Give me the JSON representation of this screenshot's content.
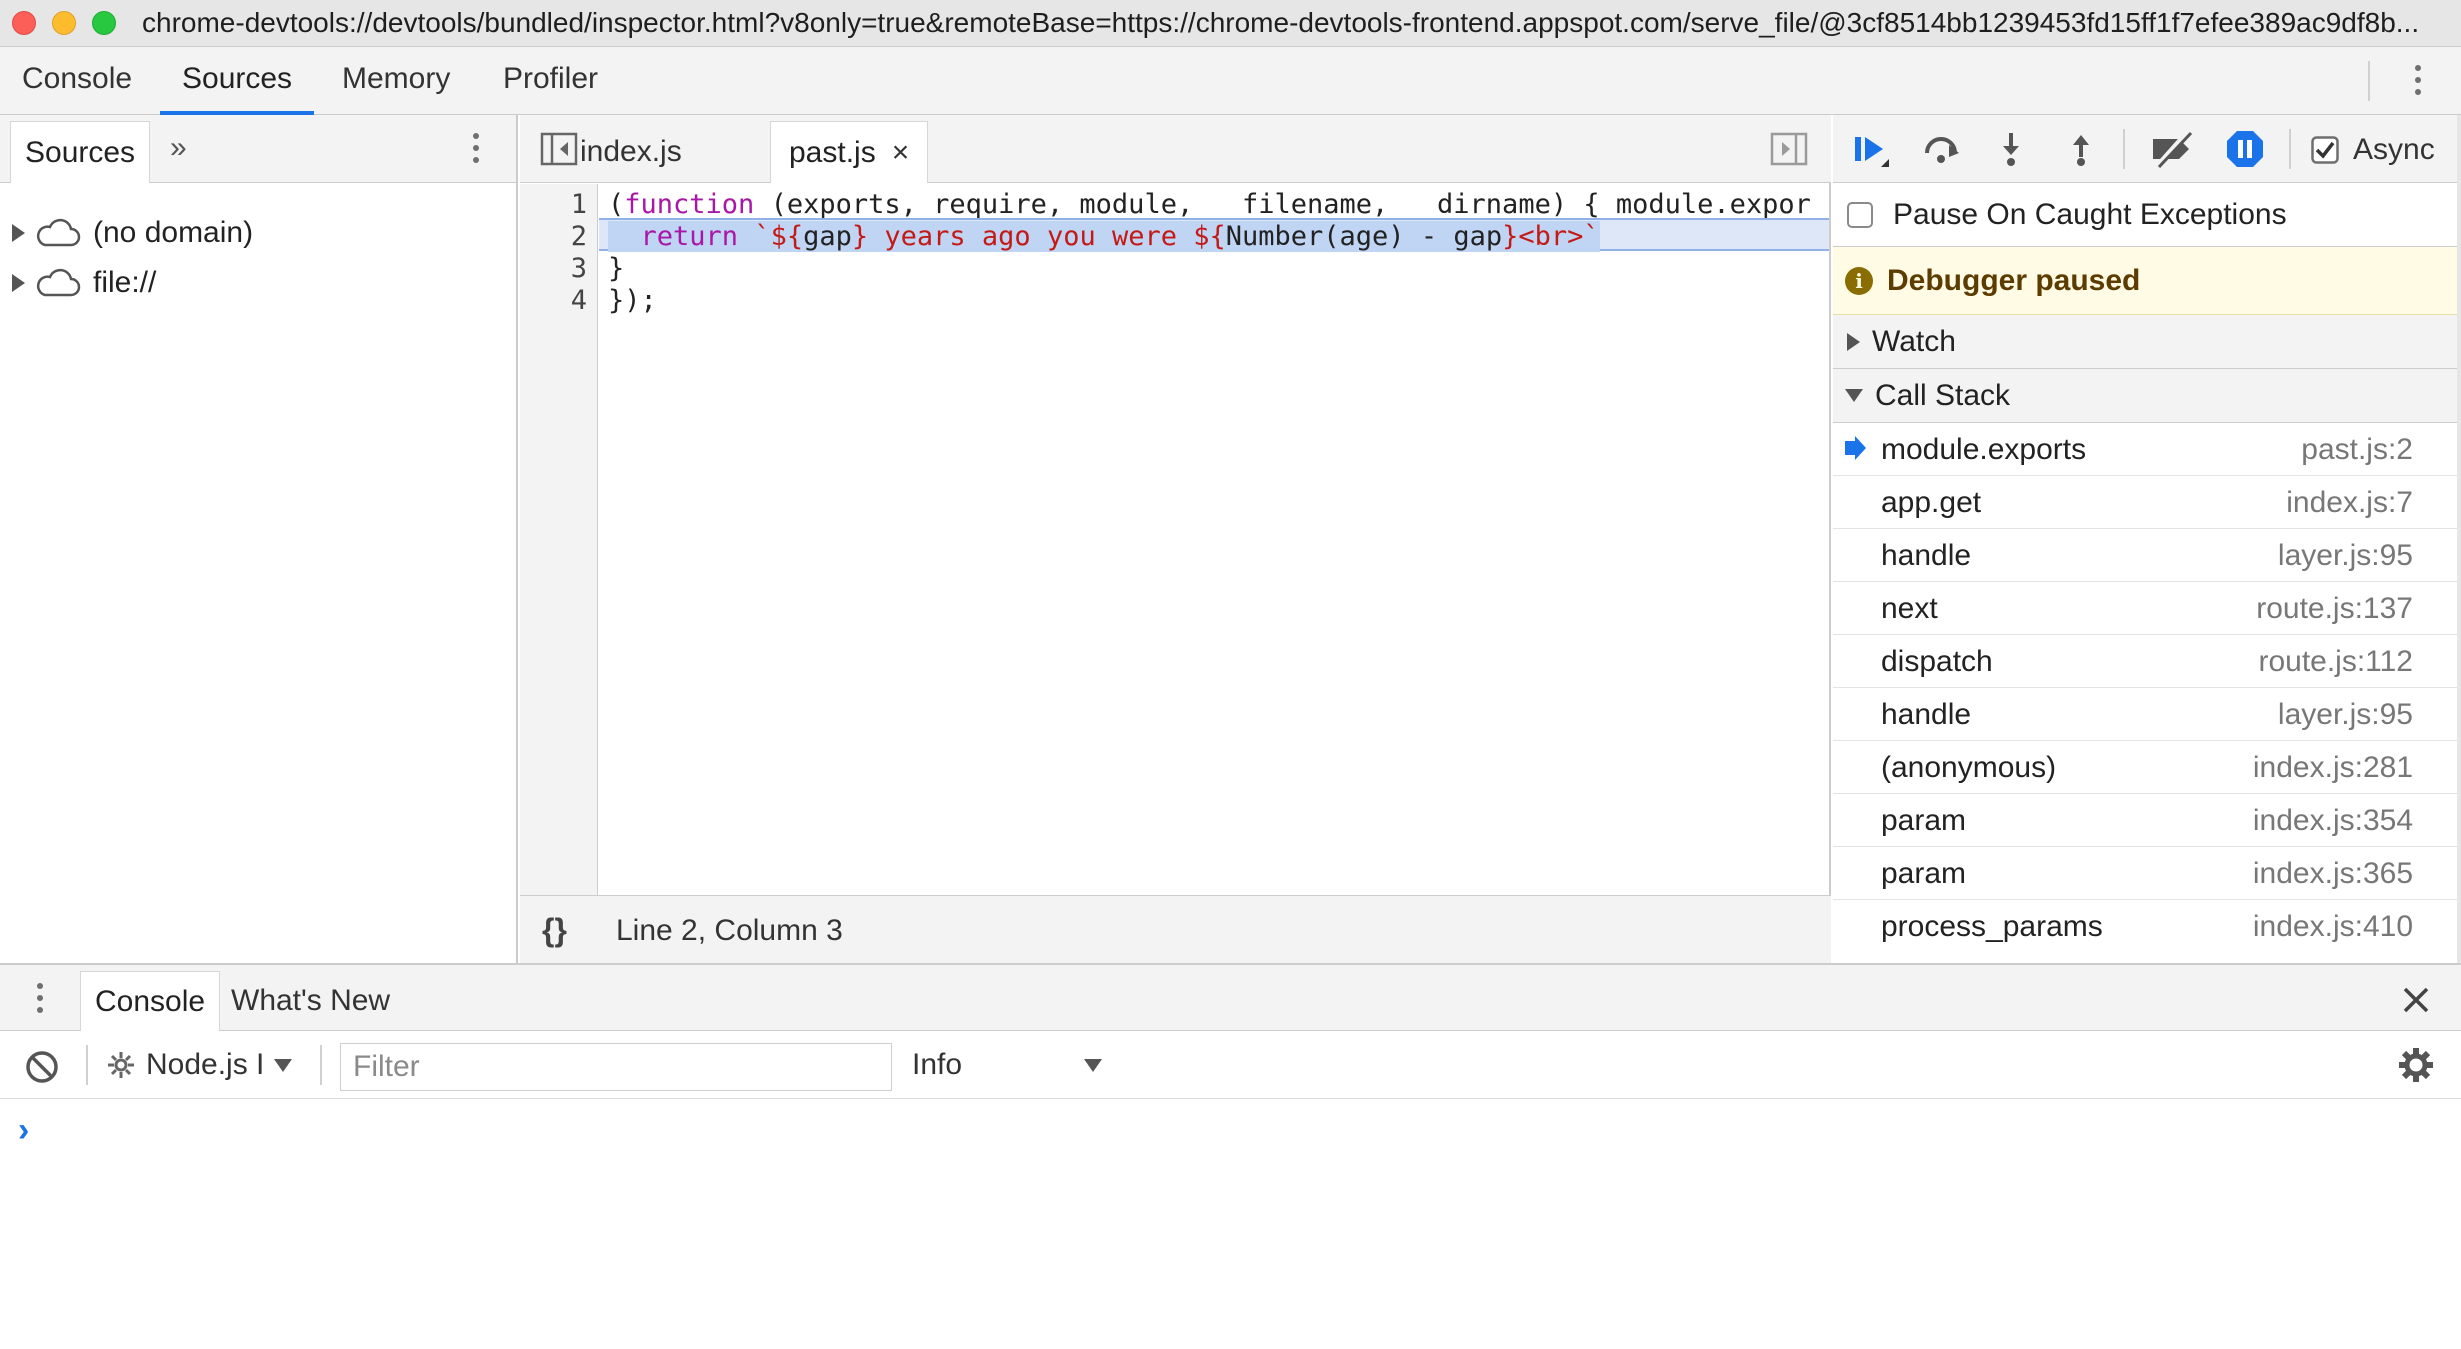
{
  "window": {
    "url": "chrome-devtools://devtools/bundled/inspector.html?v8only=true&remoteBase=https://chrome-devtools-frontend.appspot.com/serve_file/@3cf8514bb1239453fd15ff1f7efee389ac9df8b..."
  },
  "main_tabs": [
    "Console",
    "Sources",
    "Memory",
    "Profiler"
  ],
  "main_tab_active": "Sources",
  "navigator": {
    "tab_label": "Sources",
    "items": [
      "(no domain)",
      "file://"
    ]
  },
  "editor": {
    "tabs": [
      {
        "label": "index.js",
        "active": false
      },
      {
        "label": "past.js",
        "active": true,
        "close": "×"
      }
    ],
    "line_numbers": [
      "1",
      "2",
      "3",
      "4"
    ],
    "lines": {
      "l1_a": "(",
      "l1_kw": "function",
      "l1_b": " (exports, require, module, __filename, __dirname) { module.expor",
      "l2_indent": "  ",
      "l2_kw": "return",
      "l2_s1": " `${",
      "l2_v1": "gap",
      "l2_s2": "} years ago you were ${",
      "l2_v2": "Number(age) - gap",
      "l2_s3": "}<br>`",
      "l3": "}",
      "l4": "});"
    },
    "status_braces": "{}",
    "status": "Line 2, Column 3"
  },
  "debugger": {
    "async_label": "Async",
    "async_checked": true,
    "pause_on_caught": "Pause On Caught Exceptions",
    "paused_banner": "Debugger paused",
    "watch_label": "Watch",
    "call_stack_label": "Call Stack",
    "call_stack": [
      {
        "fn": "module.exports",
        "loc": "past.js:2",
        "current": true
      },
      {
        "fn": "app.get",
        "loc": "index.js:7"
      },
      {
        "fn": "handle",
        "loc": "layer.js:95"
      },
      {
        "fn": "next",
        "loc": "route.js:137"
      },
      {
        "fn": "dispatch",
        "loc": "route.js:112"
      },
      {
        "fn": "handle",
        "loc": "layer.js:95"
      },
      {
        "fn": "(anonymous)",
        "loc": "index.js:281"
      },
      {
        "fn": "param",
        "loc": "index.js:354"
      },
      {
        "fn": "param",
        "loc": "index.js:365"
      },
      {
        "fn": "process_params",
        "loc": "index.js:410"
      }
    ]
  },
  "drawer": {
    "tabs": [
      "Console",
      "What's New"
    ],
    "context": "Node.js I",
    "filter_placeholder": "Filter",
    "level": "Info",
    "prompt": "›"
  },
  "colors": {
    "accent": "#1a73e8",
    "keyword": "#a917a9",
    "string": "#c41a16",
    "paused_bg": "#fffbe5"
  }
}
